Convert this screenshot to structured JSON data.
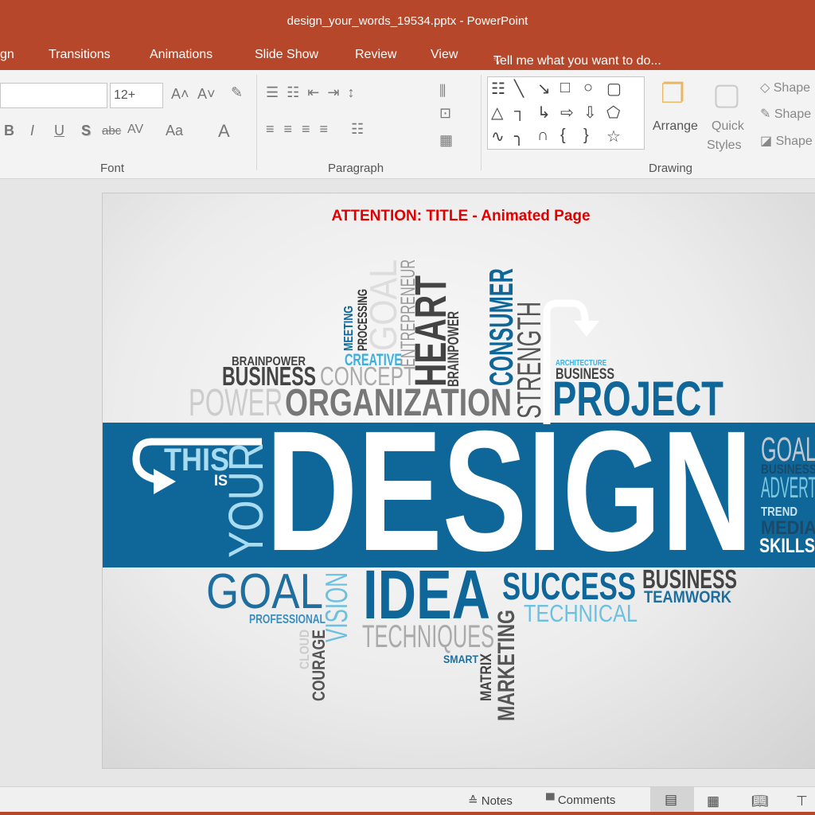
{
  "window": {
    "title": "design_your_words_19534.pptx - PowerPoint"
  },
  "tabs": [
    "gn",
    "Transitions",
    "Animations",
    "Slide Show",
    "Review",
    "View"
  ],
  "tell_me": "Tell me what you want to do...",
  "ribbon": {
    "font": {
      "name_value": "",
      "size_value": "12+",
      "group_label": "Font",
      "buttons": [
        "A˄",
        "A˅",
        "B",
        "I",
        "U",
        "S",
        "abc",
        "AV",
        "Aa",
        "A"
      ]
    },
    "paragraph": {
      "group_label": "Paragraph"
    },
    "drawing": {
      "group_label": "Drawing",
      "arrange": "Arrange",
      "quick_styles_1": "Quick",
      "quick_styles_2": "Styles",
      "shape_fill": "Shape",
      "shape_outline": "Shape",
      "shape_effects": "Shape",
      "shapes": [
        "☷",
        "╲",
        "↘",
        "□",
        "○",
        "▢",
        "△",
        "┐",
        "↳",
        "⇨",
        "⇩",
        "⬠",
        "∿",
        "╮",
        "∩",
        "{",
        "}",
        "☆"
      ]
    }
  },
  "slide": {
    "title": "ATTENTION: TITLE - Animated Page",
    "title_color": "#e00000",
    "band_color": "#0e6699",
    "words": [
      {
        "text": "BRAINPOWER",
        "color": "#444444"
      },
      {
        "text": "BUSINESS",
        "color": "#444444"
      },
      {
        "text": "CONCEPT",
        "color": "#aaaaaa"
      },
      {
        "text": "POWER",
        "color": "#cccccc"
      },
      {
        "text": "ORGANIZATION",
        "color": "#777777"
      },
      {
        "text": "CREATIVE",
        "color": "#3ab0e0"
      },
      {
        "text": "MEETING",
        "color": "#0e6699"
      },
      {
        "text": "PROCESSING",
        "color": "#333333"
      },
      {
        "text": "GOAL",
        "color": "#dddddd"
      },
      {
        "text": "ENTREPRENEUR",
        "color": "#999999"
      },
      {
        "text": "HEART",
        "color": "#444444"
      },
      {
        "text": "BRAINPOWER",
        "color": "#444444"
      },
      {
        "text": "CONSUMER",
        "color": "#0e6699"
      },
      {
        "text": "STRENGTH",
        "color": "#555555"
      },
      {
        "text": "ARCHITECTURE",
        "color": "#3ab0e0"
      },
      {
        "text": "BUSINESS",
        "color": "#444444"
      },
      {
        "text": "PROJECT",
        "color": "#0e6699"
      },
      {
        "text": "THIS",
        "color": "#a8dcf0"
      },
      {
        "text": "IS",
        "color": "#ffffff"
      },
      {
        "text": "YOUR",
        "color": "#a8dcf0"
      },
      {
        "text": "DESIGN",
        "color": "#ffffff"
      },
      {
        "text": "GOAL",
        "color": "#c0c8d0"
      },
      {
        "text": "BUSINESS",
        "color": "#1a4a6a"
      },
      {
        "text": "ADVERT",
        "color": "#7cc8e0"
      },
      {
        "text": "TREND",
        "color": "#c8e4f0"
      },
      {
        "text": "MEDIA",
        "color": "#1a4a6a"
      },
      {
        "text": "SKILLS",
        "color": "#ffffff"
      },
      {
        "text": "GOAL",
        "color": "#1e6f9f"
      },
      {
        "text": "PROFESSIONAL",
        "color": "#3a8fc0"
      },
      {
        "text": "VISION",
        "color": "#6cc0e0"
      },
      {
        "text": "CLOUD",
        "color": "#cccccc"
      },
      {
        "text": "COURAGE",
        "color": "#555555"
      },
      {
        "text": "IDEA",
        "color": "#0e6699"
      },
      {
        "text": "TECHNIQUES",
        "color": "#aaaaaa"
      },
      {
        "text": "SMART",
        "color": "#1e6f9f"
      },
      {
        "text": "MATRIX",
        "color": "#444444"
      },
      {
        "text": "MARKETING",
        "color": "#555555"
      },
      {
        "text": "SUCCESS",
        "color": "#0e6699"
      },
      {
        "text": "TECHNICAL",
        "color": "#6cc0e0"
      },
      {
        "text": "BUSINESS",
        "color": "#444444"
      },
      {
        "text": "TEAMWORK",
        "color": "#1e6f9f"
      }
    ]
  },
  "status": {
    "notes": "Notes",
    "comments": "Comments"
  },
  "colors": {
    "titlebar": "#b7472a",
    "ribbon": "#f3f3f3"
  }
}
